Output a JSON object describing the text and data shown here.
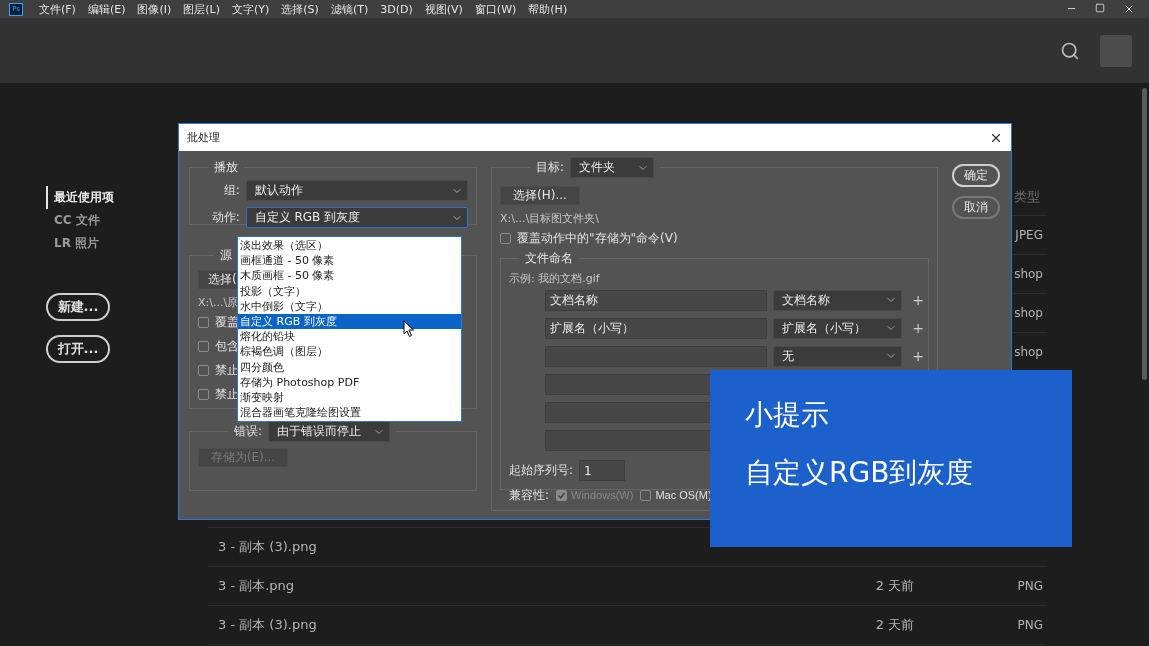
{
  "menu_bar": {
    "app_icon": "Ps",
    "items": [
      "文件(F)",
      "编辑(E)",
      "图像(I)",
      "图层(L)",
      "文字(Y)",
      "选择(S)",
      "滤镜(T)",
      "3D(D)",
      "视图(V)",
      "窗口(W)",
      "帮助(H)"
    ]
  },
  "sidebar": {
    "items": [
      {
        "label": "最近使用项",
        "selected": true
      },
      {
        "label": "CC 文件",
        "selected": false
      },
      {
        "label": "LR 照片",
        "selected": false
      }
    ],
    "buttons": [
      "新建...",
      "打开..."
    ]
  },
  "file_list": {
    "type_header": "类型",
    "rows": [
      {
        "kind": "type_only",
        "type": "JPEG"
      },
      {
        "kind": "type_only",
        "type": "shop"
      },
      {
        "kind": "type_only",
        "type": "shop"
      },
      {
        "kind": "type_only",
        "type": "shop"
      },
      {
        "kind": "blank"
      },
      {
        "kind": "blank"
      },
      {
        "kind": "blank"
      },
      {
        "kind": "blank"
      },
      {
        "kind": "name_only",
        "name": "3 - 副本 (3).png"
      },
      {
        "kind": "full",
        "name": "3 - 副本.png",
        "date": "2 天前",
        "type": "PNG"
      },
      {
        "kind": "full",
        "name": "3 - 副本 (3).png",
        "date": "2 天前",
        "type": "PNG"
      }
    ]
  },
  "dialog": {
    "title": "批处理",
    "play": {
      "legend": "播放",
      "group_label": "组:",
      "group_value": "默认动作",
      "action_label": "动作:",
      "action_value": "自定义 RGB 到灰度",
      "action_expanded": true,
      "action_options": [
        {
          "label": "淡出效果（选区）",
          "selected": false
        },
        {
          "label": "画框通道 - 50 像素",
          "selected": false
        },
        {
          "label": "木质画框 - 50 像素",
          "selected": false
        },
        {
          "label": "投影（文字）",
          "selected": false
        },
        {
          "label": "水中倒影（文字）",
          "selected": false
        },
        {
          "label": "自定义 RGB 到灰度",
          "selected": true
        },
        {
          "label": "熔化的铅块",
          "selected": false
        },
        {
          "label": "棕褐色调（图层）",
          "selected": false
        },
        {
          "label": "四分颜色",
          "selected": false
        },
        {
          "label": "存储为 Photoshop PDF",
          "selected": false
        },
        {
          "label": "渐变映射",
          "selected": false
        },
        {
          "label": "混合器画笔克隆绘图设置",
          "selected": false
        }
      ]
    },
    "source": {
      "legend": "源",
      "choose_button": "选择(",
      "path": "X:\\...\\原",
      "checkboxes": [
        {
          "label": "覆盖",
          "checked": false
        },
        {
          "label": "包含",
          "checked": false
        },
        {
          "label": "禁止",
          "checked": false
        },
        {
          "label": "禁止",
          "checked": false
        }
      ]
    },
    "errors": {
      "label": "错误:",
      "value": "由于错误而停止",
      "save_button": "存储为(E)...",
      "save_disabled": true
    },
    "destination": {
      "label": "目标:",
      "value": "文件夹",
      "choose_button": "选择(H)...",
      "path": "X:\\...\\目标图文件夹\\",
      "override": {
        "label": "覆盖动作中的\"存储为\"命令(V)",
        "checked": false
      },
      "naming": {
        "legend": "文件命名",
        "example": "示例: 我的文档.gif",
        "rows": [
          {
            "kind": "full",
            "text": "文档名称",
            "option": "文档名称",
            "add": "+"
          },
          {
            "kind": "full",
            "text": "扩展名（小写）",
            "option": "扩展名（小写）",
            "add": "+"
          },
          {
            "kind": "full",
            "option": "无",
            "add": "+"
          },
          {
            "kind": "input_only"
          },
          {
            "kind": "input_only"
          },
          {
            "kind": "input_only"
          }
        ],
        "serial_label": "起始序列号:",
        "serial_value": "1",
        "compat_label": "兼容性:",
        "compat": [
          {
            "label": "Windows(W)",
            "checked": true,
            "disabled": true
          },
          {
            "label": "Mac OS(M)",
            "checked": false,
            "disabled": false
          }
        ]
      }
    },
    "buttons": [
      "确定",
      "取消"
    ]
  },
  "tip": {
    "title": "小提示",
    "text": "自定义RGB到灰度"
  }
}
